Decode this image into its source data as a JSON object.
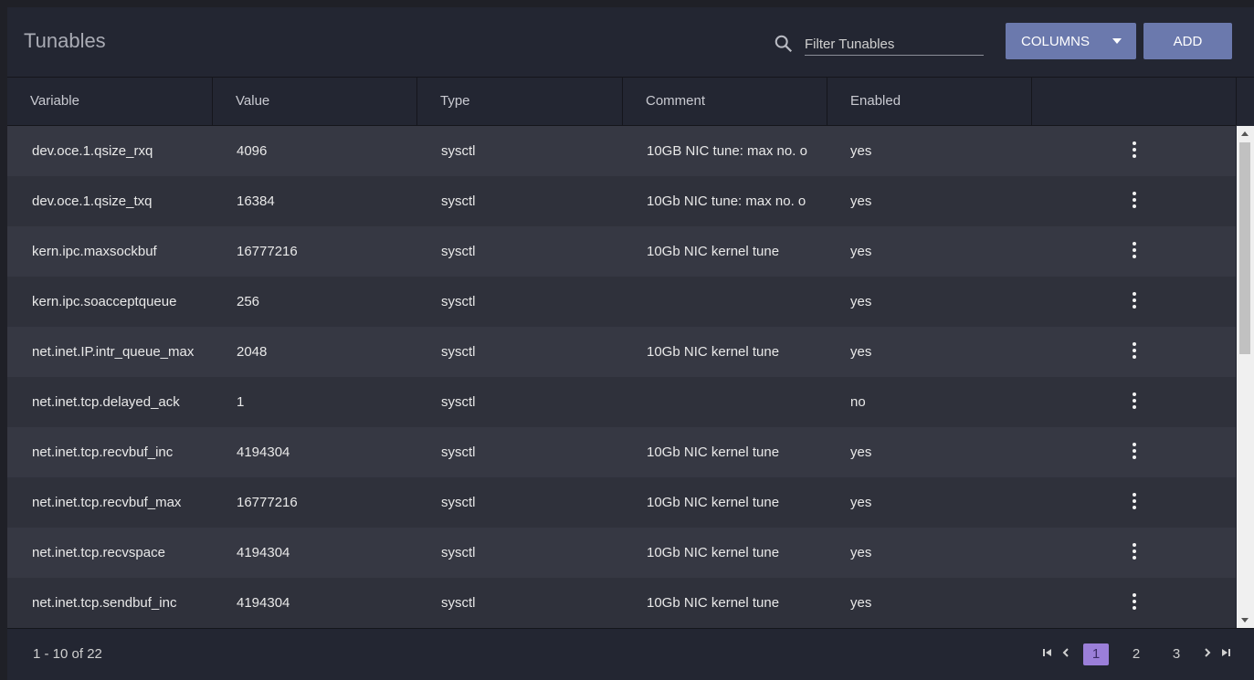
{
  "header": {
    "title": "Tunables",
    "search_placeholder": "Filter Tunables",
    "columns_label": "COLUMNS",
    "add_label": "ADD"
  },
  "table": {
    "columns": [
      "Variable",
      "Value",
      "Type",
      "Comment",
      "Enabled",
      ""
    ],
    "rows": [
      {
        "variable": "dev.oce.1.qsize_rxq",
        "value": "4096",
        "type": "sysctl",
        "comment": "10GB NIC tune: max no. o",
        "enabled": "yes"
      },
      {
        "variable": "dev.oce.1.qsize_txq",
        "value": "16384",
        "type": "sysctl",
        "comment": "10Gb NIC tune: max no. o",
        "enabled": "yes"
      },
      {
        "variable": "kern.ipc.maxsockbuf",
        "value": "16777216",
        "type": "sysctl",
        "comment": "10Gb NIC kernel tune",
        "enabled": "yes"
      },
      {
        "variable": "kern.ipc.soacceptqueue",
        "value": "256",
        "type": "sysctl",
        "comment": "",
        "enabled": "yes"
      },
      {
        "variable": "net.inet.IP.intr_queue_max",
        "value": "2048",
        "type": "sysctl",
        "comment": "10Gb NIC kernel tune",
        "enabled": "yes"
      },
      {
        "variable": "net.inet.tcp.delayed_ack",
        "value": "1",
        "type": "sysctl",
        "comment": "",
        "enabled": "no"
      },
      {
        "variable": "net.inet.tcp.recvbuf_inc",
        "value": "4194304",
        "type": "sysctl",
        "comment": "10Gb NIC kernel tune",
        "enabled": "yes"
      },
      {
        "variable": "net.inet.tcp.recvbuf_max",
        "value": "16777216",
        "type": "sysctl",
        "comment": "10Gb NIC kernel tune",
        "enabled": "yes"
      },
      {
        "variable": "net.inet.tcp.recvspace",
        "value": "4194304",
        "type": "sysctl",
        "comment": "10Gb NIC kernel tune",
        "enabled": "yes"
      },
      {
        "variable": "net.inet.tcp.sendbuf_inc",
        "value": "4194304",
        "type": "sysctl",
        "comment": "10Gb NIC kernel tune",
        "enabled": "yes"
      }
    ]
  },
  "footer": {
    "range_text": "1 - 10 of 22",
    "pages": [
      "1",
      "2",
      "3"
    ],
    "current_page": "1"
  },
  "colors": {
    "accent": "#6b79ad",
    "active_page": "#9b7fd9"
  }
}
